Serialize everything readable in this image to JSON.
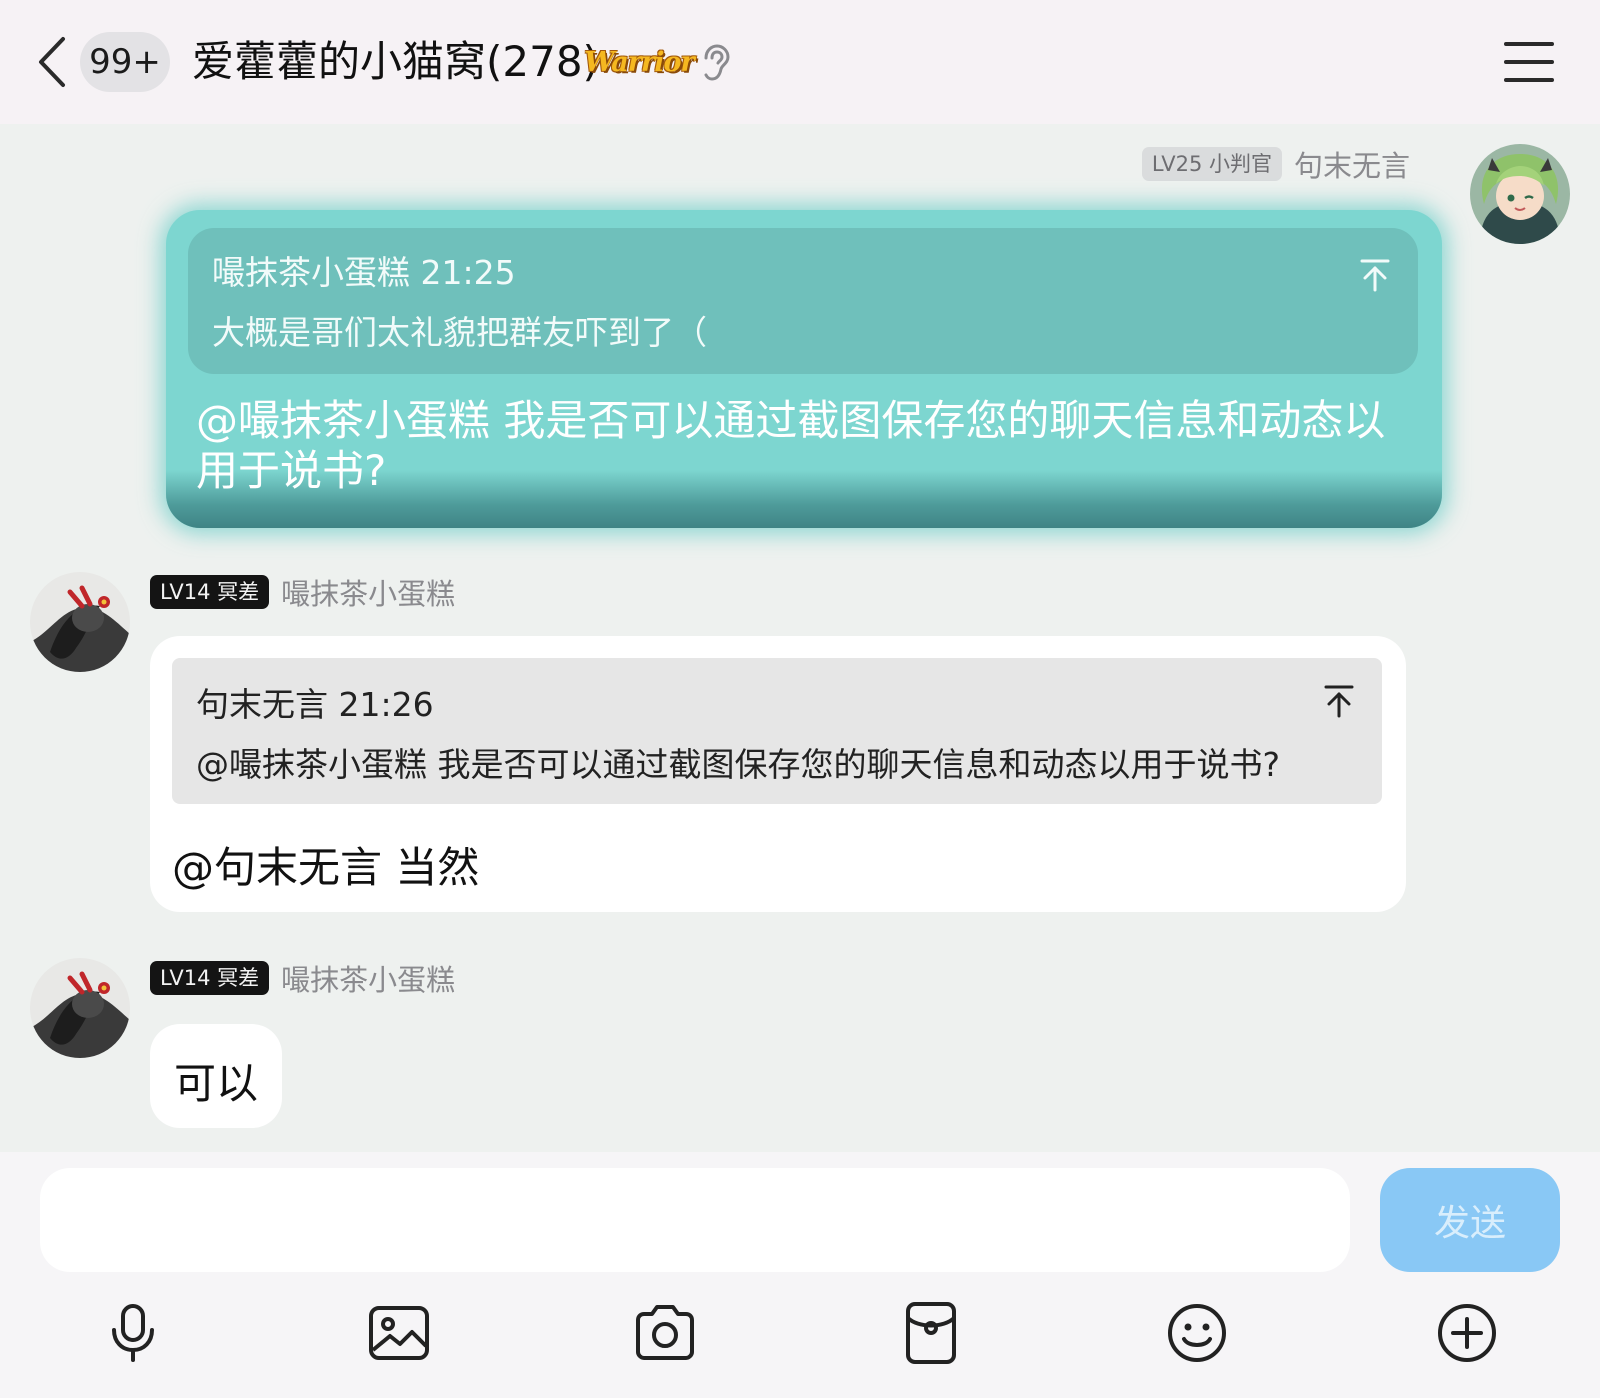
{
  "header": {
    "unread_count": "99+",
    "title": "爱藿藿的小猫窝(278)",
    "title_badge": "Warrior"
  },
  "messages": [
    {
      "sender": "句末无言",
      "level_badge": "LV25 小判官",
      "is_self": true,
      "quote": {
        "head": "嘬抹茶小蛋糕 21:25",
        "body": "大概是哥们太礼貌把群友吓到了（"
      },
      "text": "@嘬抹茶小蛋糕 我是否可以通过截图保存您的聊天信息和动态以用于说书?"
    },
    {
      "sender": "嘬抹茶小蛋糕",
      "level_badge": "LV14 冥差",
      "is_self": false,
      "quote": {
        "head": "句末无言 21:26",
        "body": "@嘬抹茶小蛋糕 我是否可以通过截图保存您的聊天信息和动态以用于说书?"
      },
      "text": "@句末无言 当然"
    },
    {
      "sender": "嘬抹茶小蛋糕",
      "level_badge": "LV14 冥差",
      "is_self": false,
      "text": "可以"
    }
  ],
  "composer": {
    "input_value": "",
    "send_label": "发送"
  },
  "toolbar": {
    "icons": [
      "microphone-icon",
      "image-icon",
      "camera-icon",
      "red-packet-icon",
      "emoji-icon",
      "plus-icon"
    ]
  },
  "colors": {
    "accent": "#89c8f5",
    "self_bubble": "#7dd6d0",
    "background": "#eef1ef"
  }
}
